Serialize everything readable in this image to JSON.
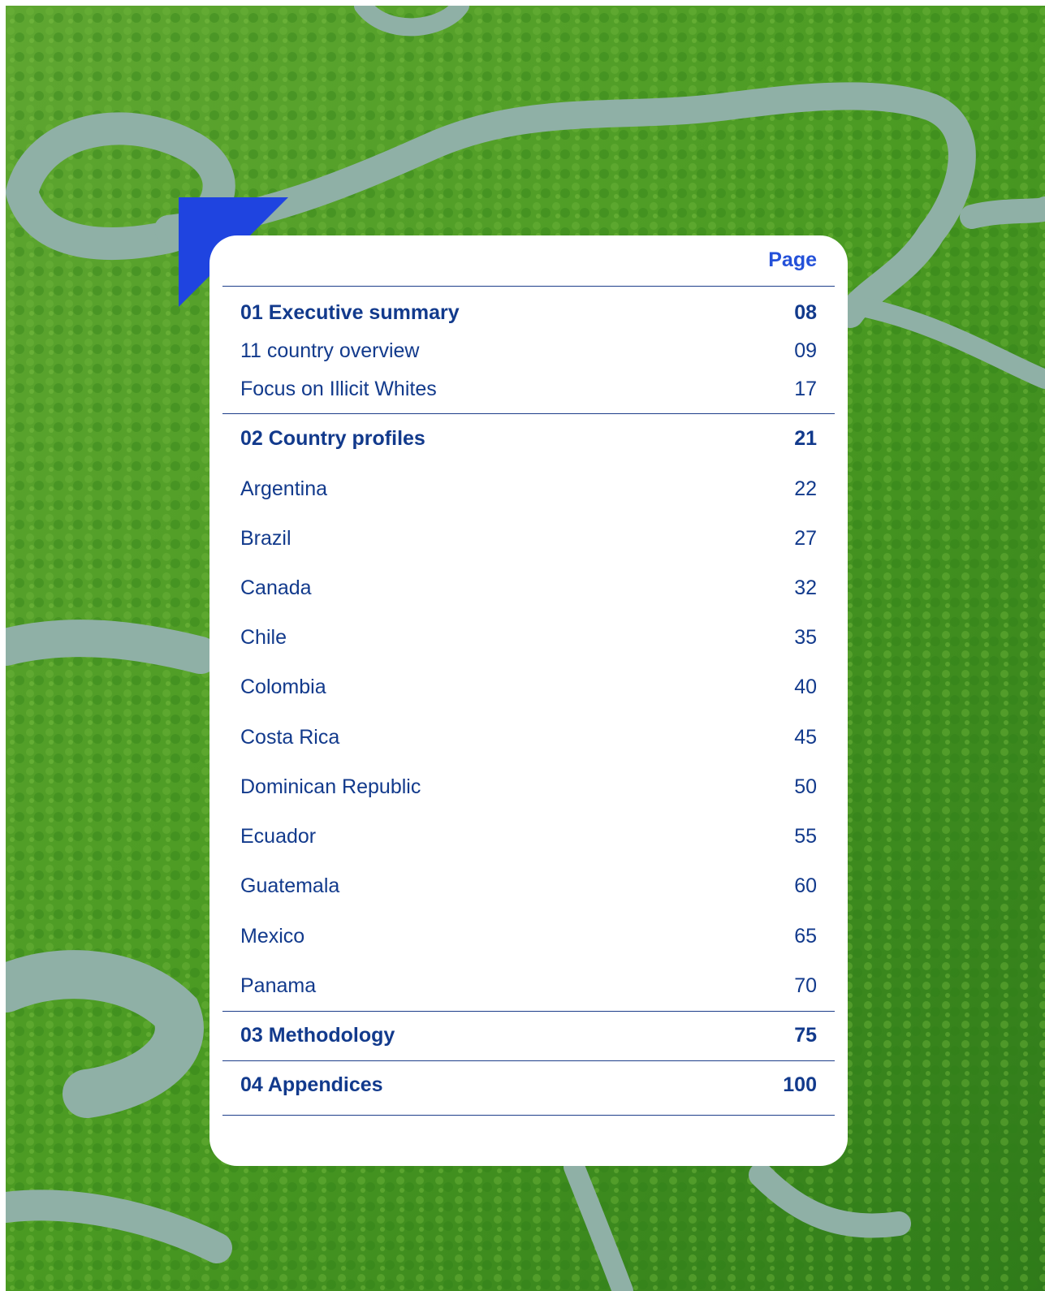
{
  "header": {
    "page_label": "Page"
  },
  "toc": {
    "sections": [
      {
        "title": "01 Executive summary",
        "page": "08",
        "items": [
          {
            "title": "11 country overview",
            "page": "09"
          },
          {
            "title": "Focus on Illicit Whites",
            "page": "17"
          }
        ]
      },
      {
        "title": "02 Country profiles",
        "page": "21",
        "items": [
          {
            "title": "Argentina",
            "page": "22"
          },
          {
            "title": "Brazil",
            "page": "27"
          },
          {
            "title": "Canada",
            "page": "32"
          },
          {
            "title": "Chile",
            "page": "35"
          },
          {
            "title": "Colombia",
            "page": "40"
          },
          {
            "title": "Costa Rica",
            "page": "45"
          },
          {
            "title": "Dominican Republic",
            "page": "50"
          },
          {
            "title": "Ecuador",
            "page": "55"
          },
          {
            "title": "Guatemala",
            "page": "60"
          },
          {
            "title": "Mexico",
            "page": "65"
          },
          {
            "title": "Panama",
            "page": "70"
          }
        ]
      },
      {
        "title": "03 Methodology",
        "page": "75",
        "items": []
      },
      {
        "title": "04 Appendices",
        "page": "100",
        "items": []
      }
    ]
  },
  "colors": {
    "text": "#123a8c",
    "accent": "#1f44e0",
    "page_label": "#2451d9",
    "rule": "#1d3e8a",
    "forest": "#3f8f1e",
    "river": "#8fb0a6"
  },
  "background": {
    "icon": "aerial-forest-river-photo"
  }
}
